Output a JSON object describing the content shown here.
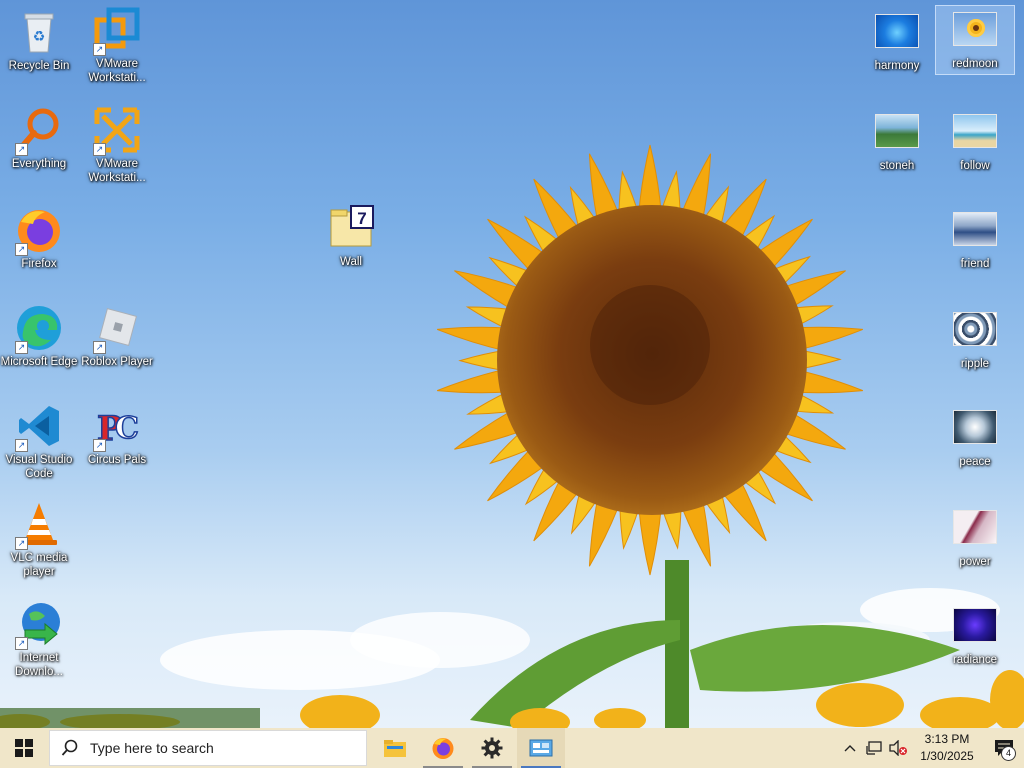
{
  "desktop": {
    "left_icons": [
      {
        "label": "Recycle Bin",
        "icon": "recycle-bin-icon"
      },
      {
        "label": "VMware Workstati...",
        "icon": "vmware-icon"
      },
      {
        "label": "Everything",
        "icon": "everything-search-icon"
      },
      {
        "label": "VMware Workstati...",
        "icon": "vmware-workstation-icon"
      },
      {
        "label": "Firefox",
        "icon": "firefox-icon"
      },
      {
        "label": "Microsoft Edge",
        "icon": "edge-icon"
      },
      {
        "label": "Roblox Player",
        "icon": "roblox-icon"
      },
      {
        "label": "Visual Studio Code",
        "icon": "vscode-icon"
      },
      {
        "label": "Circus Pals",
        "icon": "circus-pals-icon"
      },
      {
        "label": "VLC media player",
        "icon": "vlc-icon"
      },
      {
        "label": "Internet Downlo...",
        "icon": "idm-icon"
      },
      {
        "label": "Wall",
        "icon": "7zip-archive-icon"
      }
    ],
    "right_icons": [
      {
        "label": "harmony",
        "icon": "image-thumbnail-icon"
      },
      {
        "label": "redmoon",
        "icon": "image-thumbnail-icon",
        "selected": true
      },
      {
        "label": "stoneh",
        "icon": "image-thumbnail-icon"
      },
      {
        "label": "follow",
        "icon": "image-thumbnail-icon"
      },
      {
        "label": "friend",
        "icon": "image-thumbnail-icon"
      },
      {
        "label": "ripple",
        "icon": "image-thumbnail-icon"
      },
      {
        "label": "peace",
        "icon": "image-thumbnail-icon"
      },
      {
        "label": "power",
        "icon": "image-thumbnail-icon"
      },
      {
        "label": "radiance",
        "icon": "image-thumbnail-icon"
      }
    ]
  },
  "taskbar": {
    "search_placeholder": "Type here to search",
    "pinned": [
      {
        "name": "file-explorer-icon"
      },
      {
        "name": "firefox-icon"
      },
      {
        "name": "settings-gear-icon"
      },
      {
        "name": "control-panel-icon",
        "active": true
      }
    ],
    "clock_time": "3:13 PM",
    "clock_date": "1/30/2025",
    "notification_count": "4"
  },
  "colors": {
    "taskbar_bg": "#f0e6c9",
    "sky_top": "#5f95d8",
    "petal": "#f7b618",
    "seed_center": "#7a3d10"
  }
}
